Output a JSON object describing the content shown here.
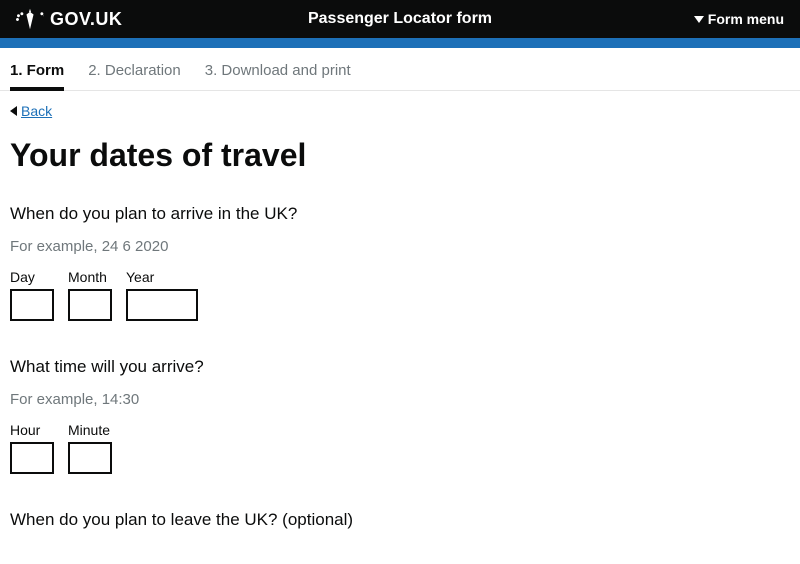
{
  "header": {
    "site": "GOV.UK",
    "service": "Passenger Locator form",
    "menu": "Form menu"
  },
  "tabs": [
    {
      "label": "1. Form",
      "active": true
    },
    {
      "label": "2. Declaration",
      "active": false
    },
    {
      "label": "3. Download and print",
      "active": false
    }
  ],
  "back": "Back",
  "heading": "Your dates of travel",
  "arrive": {
    "question": "When do you plan to arrive in the UK?",
    "hint": "For example, 24 6 2020",
    "day_label": "Day",
    "month_label": "Month",
    "year_label": "Year",
    "day": "",
    "month": "",
    "year": ""
  },
  "time": {
    "question": "What time will you arrive?",
    "hint": "For example, 14:30",
    "hour_label": "Hour",
    "minute_label": "Minute",
    "hour": "",
    "minute": ""
  },
  "leave": {
    "question": "When do you plan to leave the UK? (optional)"
  }
}
